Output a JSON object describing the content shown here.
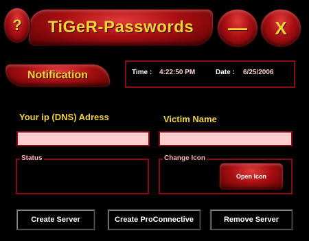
{
  "window": {
    "title": "TiGeR-Passwords",
    "help_label": "?",
    "minimize_label": "—",
    "close_label": "X"
  },
  "notification_label": "Notification",
  "datetime": {
    "time_label": "Time :",
    "time_value": "4:22:50 PM",
    "date_label": "Date :",
    "date_value": "6/25/2006"
  },
  "form": {
    "ip_label": "Your ip (DNS) Adress",
    "ip_value": "",
    "victim_label": "Victim Name",
    "victim_value": ""
  },
  "groups": {
    "status_legend": "Status",
    "change_icon_legend": "Change Icon",
    "open_icon_label": "Open Icon"
  },
  "actions": {
    "create_server": "Create Server",
    "create_proconnective": "Create ProConnective",
    "remove_server": "Remove Server"
  },
  "colors": {
    "accent_red": "#a80f12",
    "title_yellow": "#f3d33a",
    "input_pink": "#ffcfcf",
    "background": "#000000"
  }
}
